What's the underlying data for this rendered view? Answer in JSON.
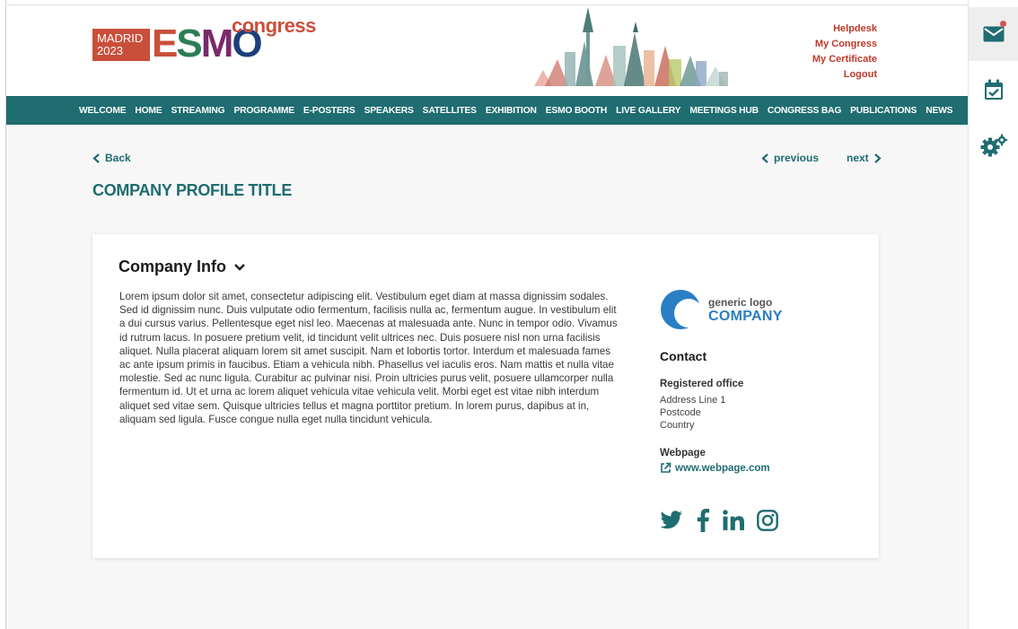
{
  "colors": {
    "teal": "#1f6c71",
    "red": "#c0392b",
    "background": "#f7f7f7",
    "card": "#ffffff"
  },
  "header": {
    "logo": {
      "madrid": "MADRID",
      "year": "2023",
      "esmo": "ESMO",
      "congress": "congress"
    },
    "links": [
      "Helpdesk",
      "My Congress",
      "My Certificate",
      "Logout"
    ]
  },
  "nav": {
    "items": [
      "WELCOME",
      "HOME",
      "STREAMING",
      "PROGRAMME",
      "E-POSTERS",
      "SPEAKERS",
      "SATELLITES",
      "EXHIBITION",
      "ESMO BOOTH",
      "LIVE GALLERY",
      "MEETINGS HUB",
      "CONGRESS BAG",
      "PUBLICATIONS",
      "NEWS"
    ]
  },
  "pager": {
    "back": "Back",
    "previous": "previous",
    "next": "next"
  },
  "page": {
    "title": "COMPANY PROFILE TITLE"
  },
  "company": {
    "section_title": "Company Info",
    "description": "Lorem ipsum dolor sit amet, consectetur adipiscing elit. Vestibulum eget diam at massa dignissim sodales. Sed id dignissim nunc. Duis vulputate odio fermentum, facilisis nulla ac, fermentum augue. In vestibulum elit a dui cursus varius. Pellentesque eget nisl leo. Maecenas at malesuada ante. Nunc in tempor odio. Vivamus id rutrum lacus. In posuere pretium velit, id tincidunt velit ultrices nec. Duis posuere nisl non urna facilisis aliquet. Nulla placerat aliquam lorem sit amet suscipit. Nam et lobortis tortor. Interdum et malesuada fames ac ante ipsum primis in faucibus. Etiam a vehicula nibh. Phasellus vel iaculis eros. Nam mattis et nulla vitae molestie. Sed ac nunc ligula. Curabitur ac pulvinar nisi. Proin ultricies purus velit, posuere ullamcorper nulla fermentum id. Ut et urna ac lorem aliquet vehicula vitae vehicula velit. Morbi eget est vitae nibh interdum aliquet sed vitae sem. Quisque ultricies tellus et magna porttitor pretium. In lorem purus, dapibus at in, aliquam sed ligula. Fusce congue nulla eget nulla tincidunt vehicula.",
    "logo_generic": "generic logo",
    "logo_company": "COMPANY",
    "contact_title": "Contact",
    "registered_office_label": "Registered office",
    "address": [
      "Address Line 1",
      "Postcode",
      "Country"
    ],
    "webpage_label": "Webpage",
    "webpage": "www.webpage.com",
    "socials": [
      "twitter-icon",
      "facebook-icon",
      "linkedin-icon",
      "instagram-icon"
    ]
  },
  "toolbar": {
    "icons": [
      "mail-icon",
      "calendar-check-icon",
      "gears-icon"
    ]
  }
}
